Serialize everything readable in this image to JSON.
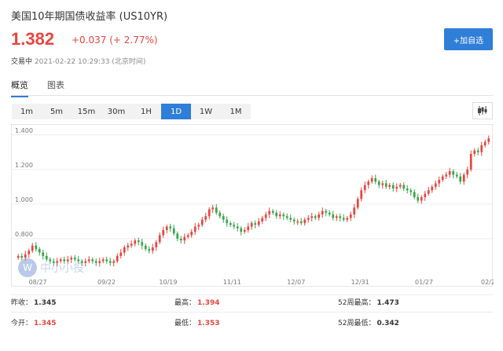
{
  "header": {
    "title": "美国10年期国债收益率 (US10YR)",
    "price": "1.382",
    "change": "+0.037 (+ 2.77%)",
    "status_label": "交易中",
    "status_time": "2021-02-22 10:29:33 (北京时间)",
    "add_button": "+加自选"
  },
  "tabs": [
    {
      "label": "概览",
      "active": true
    },
    {
      "label": "图表",
      "active": false
    }
  ],
  "ranges": [
    {
      "label": "1m"
    },
    {
      "label": "5m"
    },
    {
      "label": "15m"
    },
    {
      "label": "30m"
    },
    {
      "label": "1H"
    },
    {
      "label": "1D"
    },
    {
      "label": "1W"
    },
    {
      "label": "1M"
    }
  ],
  "active_range": "1D",
  "chart_type_icon": "candlestick-icon",
  "colors": {
    "up": "#e8443e",
    "down": "#35a54a",
    "accent": "#2f7ed8"
  },
  "chart_data": {
    "type": "candlestick",
    "title": "",
    "y_ticks": [
      "1.400",
      "1.200",
      "1.000",
      "0.800"
    ],
    "ylim": [
      0.6,
      1.44
    ],
    "x_ticks": [
      "08/27",
      "09/22",
      "10/19",
      "11/11",
      "12/07",
      "12/31",
      "01/27",
      "02/2"
    ],
    "candles": [
      0.7,
      0.69,
      0.71,
      0.73,
      0.76,
      0.74,
      0.72,
      0.7,
      0.68,
      0.67,
      0.66,
      0.67,
      0.68,
      0.67,
      0.68,
      0.69,
      0.68,
      0.67,
      0.66,
      0.67,
      0.68,
      0.67,
      0.66,
      0.67,
      0.68,
      0.67,
      0.66,
      0.67,
      0.7,
      0.72,
      0.75,
      0.76,
      0.77,
      0.79,
      0.78,
      0.76,
      0.74,
      0.73,
      0.75,
      0.78,
      0.82,
      0.85,
      0.87,
      0.86,
      0.83,
      0.8,
      0.79,
      0.81,
      0.82,
      0.84,
      0.87,
      0.88,
      0.91,
      0.93,
      0.97,
      0.98,
      0.95,
      0.93,
      0.91,
      0.89,
      0.88,
      0.87,
      0.86,
      0.84,
      0.85,
      0.87,
      0.89,
      0.88,
      0.9,
      0.92,
      0.94,
      0.96,
      0.95,
      0.93,
      0.94,
      0.93,
      0.92,
      0.91,
      0.9,
      0.9,
      0.89,
      0.91,
      0.92,
      0.93,
      0.92,
      0.94,
      0.96,
      0.95,
      0.94,
      0.92,
      0.93,
      0.92,
      0.91,
      0.92,
      0.94,
      0.98,
      1.03,
      1.08,
      1.11,
      1.13,
      1.15,
      1.13,
      1.11,
      1.12,
      1.1,
      1.11,
      1.09,
      1.1,
      1.11,
      1.09,
      1.08,
      1.07,
      1.04,
      1.02,
      1.04,
      1.06,
      1.08,
      1.1,
      1.12,
      1.14,
      1.16,
      1.17,
      1.19,
      1.17,
      1.16,
      1.13,
      1.17,
      1.2,
      1.29,
      1.31,
      1.3,
      1.34,
      1.36,
      1.38
    ],
    "stats": [
      {
        "label": "昨收：",
        "value": "1.345",
        "color": "default"
      },
      {
        "label": "最高：",
        "value": "1.394",
        "color": "red"
      },
      {
        "label": "52周最高：",
        "value": "1.473",
        "color": "default"
      },
      {
        "label": "今开：",
        "value": "1.345",
        "color": "red"
      },
      {
        "label": "最低：",
        "value": "1.353",
        "color": "red"
      },
      {
        "label": "52周最低：",
        "value": "0.342",
        "color": "default"
      }
    ]
  },
  "watermark": {
    "logo": "W",
    "text": "中小小投"
  }
}
